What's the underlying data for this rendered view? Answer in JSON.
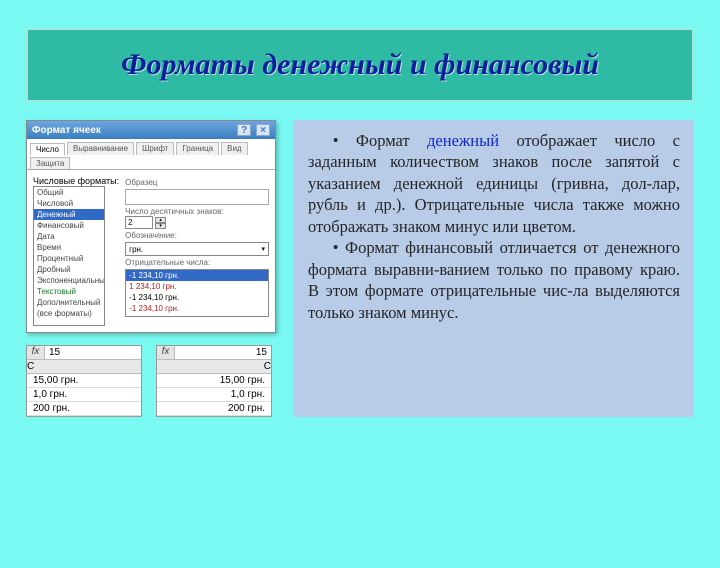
{
  "title": "Форматы денежный и финансовый",
  "text": {
    "para1a": "• Формат ",
    "money_word": "денежный",
    "para1b": " отображает число с заданным количеством знаков после запятой с указанием денежной единицы (гривна, дол-лар, рубль и др.). Отрицательные числа также можно отображать знаком минус или цветом.",
    "para2": "• Формат финансовый отличается от денежного формата выравни-ванием только по правому краю. В этом формате отрицательные чис-ла выделяются только знаком минус."
  },
  "dialog": {
    "title": "Формат ячеек",
    "help": "?",
    "close": "×",
    "tabs": [
      "Число",
      "Выравнивание",
      "Шрифт",
      "Граница",
      "Вид",
      "Защита"
    ],
    "active_tab": 0,
    "list_label": "Числовые форматы:",
    "formats": [
      "Общий",
      "Числовой",
      "Денежный",
      "Финансовый",
      "Дата",
      "Время",
      "Процентный",
      "Дробный",
      "Экспоненциальный",
      "Текстовый",
      "Дополнительный",
      "(все форматы)"
    ],
    "selected": 2,
    "sample_label": "Образец",
    "decimals_label": "Число десятичных знаков:",
    "decimals_value": "2",
    "unit_label": "Обозначение:",
    "unit_value": "грн.",
    "neg_label": "Отрицательные числа:",
    "neg_items": [
      "-1 234,10 грн.",
      "1 234,10 грн.",
      "-1 234,10 грн.",
      "-1 234,10 грн."
    ]
  },
  "tables": {
    "fx": "fx",
    "fx_val": "15",
    "col": "C",
    "left_rows": [
      "15,00 грн.",
      "1,0 грн.",
      "200 грн."
    ],
    "right_rows": [
      "15,00 грн.",
      "1,0 грн.",
      "200 грн."
    ]
  }
}
